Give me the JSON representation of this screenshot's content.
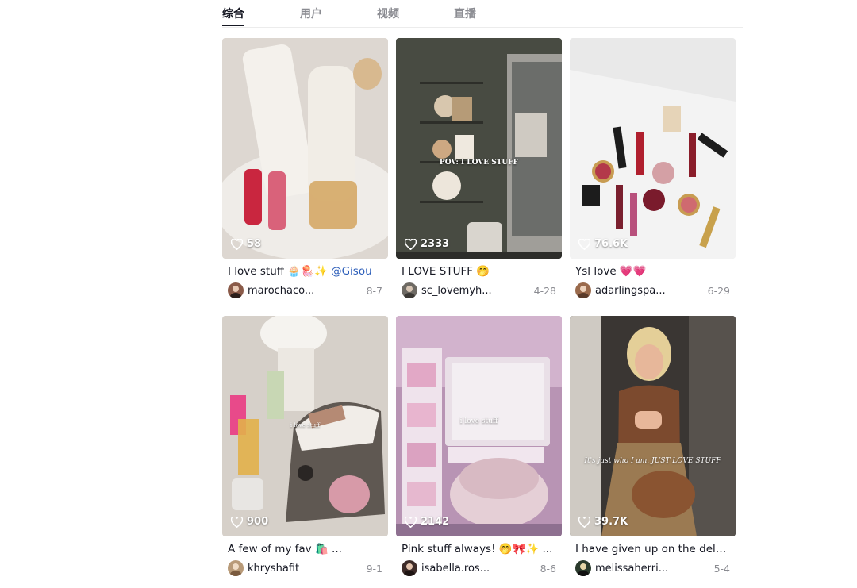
{
  "tabs": [
    {
      "label": "综合",
      "active": true
    },
    {
      "label": "用户",
      "active": false
    },
    {
      "label": "视频",
      "active": false
    },
    {
      "label": "直播",
      "active": false
    }
  ],
  "videos": [
    {
      "likes": "58",
      "caption": "I love stuff 🧁🪼✨",
      "mention": "@Gisou",
      "author": "marochaco...",
      "date": "8-7",
      "overlay": "",
      "thumb_colors": [
        "#e9e4df",
        "#c9c2bb"
      ],
      "avatar_color": "#8a5a48"
    },
    {
      "likes": "2333",
      "caption": "I LOVE STUFF 🤭",
      "mention": "",
      "author": "sc_lovemyh...",
      "date": "4-28",
      "overlay": "POV: I LOVE STUFF",
      "thumb_colors": [
        "#4a4d44",
        "#8d8b86"
      ],
      "avatar_color": "#6e6a64"
    },
    {
      "likes": "76.6K",
      "caption": "Ysl love 💗💗",
      "mention": "",
      "author": "adarlingspa...",
      "date": "6-29",
      "overlay": "",
      "thumb_colors": [
        "#f2f2f2",
        "#d9d9d9"
      ],
      "avatar_color": "#9a6a4c"
    },
    {
      "likes": "900",
      "caption": "A few of my fav 🛍️ ...",
      "mention": "",
      "author": "khryshafit",
      "date": "9-1",
      "overlay": "i love stuff",
      "thumb_colors": [
        "#d8d2cc",
        "#6d6660"
      ],
      "avatar_color": "#b89a78"
    },
    {
      "likes": "2142",
      "caption": "Pink stuff always! 🤭🎀✨ ...",
      "mention": "",
      "author": "isabella.ros...",
      "date": "8-6",
      "overlay": "i love stuff",
      "thumb_colors": [
        "#cba6c3",
        "#8b6f8c"
      ],
      "avatar_color": "#3d2b28"
    },
    {
      "likes": "39.7K",
      "caption": "I have given up on the delusi...",
      "mention": "",
      "author": "melissaherri...",
      "date": "5-4",
      "overlay": "It's just who I am. JUST LOVE STUFF",
      "thumb_colors": [
        "#5a5550",
        "#2e2a26"
      ],
      "avatar_color": "#2a3a2c"
    }
  ]
}
